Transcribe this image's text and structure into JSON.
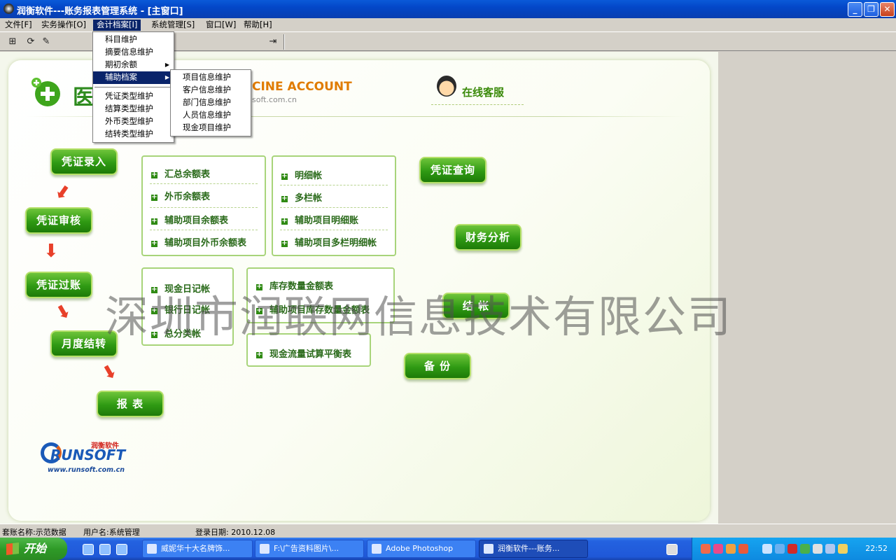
{
  "window": {
    "title": "润衡软件---账务报表管理系统 - [主窗口]"
  },
  "menubar": [
    "文件[F]",
    "实务操作[O]",
    "会计档案[I]",
    "系统管理[S]",
    "窗口[W]",
    "帮助[H]"
  ],
  "accounting_menu": {
    "items": [
      "科目维护",
      "摘要信息维护",
      "期初余额",
      "辅助档案",
      "凭证类型维护",
      "结算类型维护",
      "外币类型维护",
      "结转类型维护"
    ],
    "highlighted": "辅助档案"
  },
  "aux_submenu": [
    "项目信息维护",
    "客户信息维护",
    "部门信息维护",
    "人员信息维护",
    "现金项目维护"
  ],
  "header": {
    "logo_cn": "医",
    "logo_en": "CINE ACCOUNT",
    "logo_url": "soft.com.cn",
    "online_service": "在线客服"
  },
  "flow": {
    "voucher_entry": "凭证录入",
    "voucher_review": "凭证审核",
    "voucher_post": "凭证过账",
    "month_close": "月度结转",
    "report": "报 表"
  },
  "right_buttons": {
    "voucher_query": "凭证查询",
    "finance_analysis": "财务分析",
    "close_books": "结 帐",
    "backup": "备 份"
  },
  "box_balance": [
    "汇总余额表",
    "外币余额表",
    "辅助项目余额表",
    "辅助项目外币余额表"
  ],
  "box_detail": [
    "明细帐",
    "多栏帐",
    "辅助项目明细账",
    "辅助项目多栏明细帐"
  ],
  "box_journal": [
    "现金日记帐",
    "银行日记帐",
    "总分类帐"
  ],
  "box_inventory": [
    "库存数量金额表",
    "辅助项目库存数量金额表"
  ],
  "box_cashflow": [
    "现金流量试算平衡表"
  ],
  "watermark": "深圳市润联网信息技术有限公司",
  "runsoft": {
    "cn": "润衡软件",
    "en": "RUNSOFT",
    "url": "www.runsoft.com.cn"
  },
  "statusbar": {
    "account": "套账名称:示范数据",
    "user": "用户名:系统管理",
    "login_date": "登录日期: 2010.12.08"
  },
  "taskbar": {
    "start": "开始",
    "tasks": [
      "威妮华十大名牌饰...",
      "F:\\广告资料图片\\...",
      "Adobe Photoshop",
      "润衡软件---账务..."
    ],
    "clock": "22:52"
  }
}
